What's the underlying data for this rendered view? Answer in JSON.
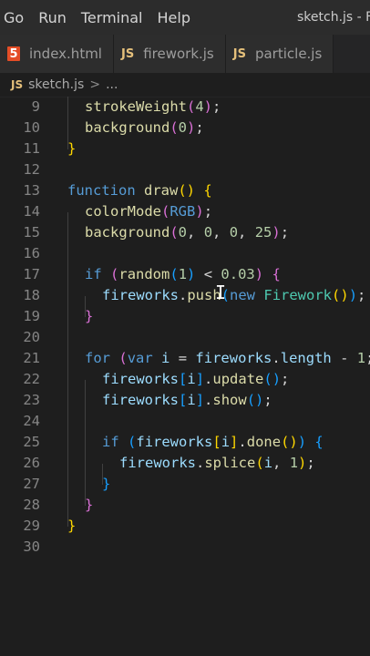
{
  "menubar": {
    "items": [
      "Go",
      "Run",
      "Terminal",
      "Help"
    ],
    "window_title": "sketch.js - Fi"
  },
  "tabs": [
    {
      "label": "index.html",
      "icon": "html5-icon"
    },
    {
      "label": "firework.js",
      "icon": "js-icon"
    },
    {
      "label": "particle.js",
      "icon": "js-icon"
    }
  ],
  "breadcrumbs": {
    "icon_label": "JS",
    "file": "sketch.js",
    "separator": ">",
    "more": "..."
  },
  "editor": {
    "line_numbers": [
      "9",
      "10",
      "11",
      "12",
      "13",
      "14",
      "15",
      "16",
      "17",
      "18",
      "19",
      "20",
      "21",
      "22",
      "23",
      "24",
      "25",
      "26",
      "27",
      "28",
      "29",
      "30"
    ]
  }
}
